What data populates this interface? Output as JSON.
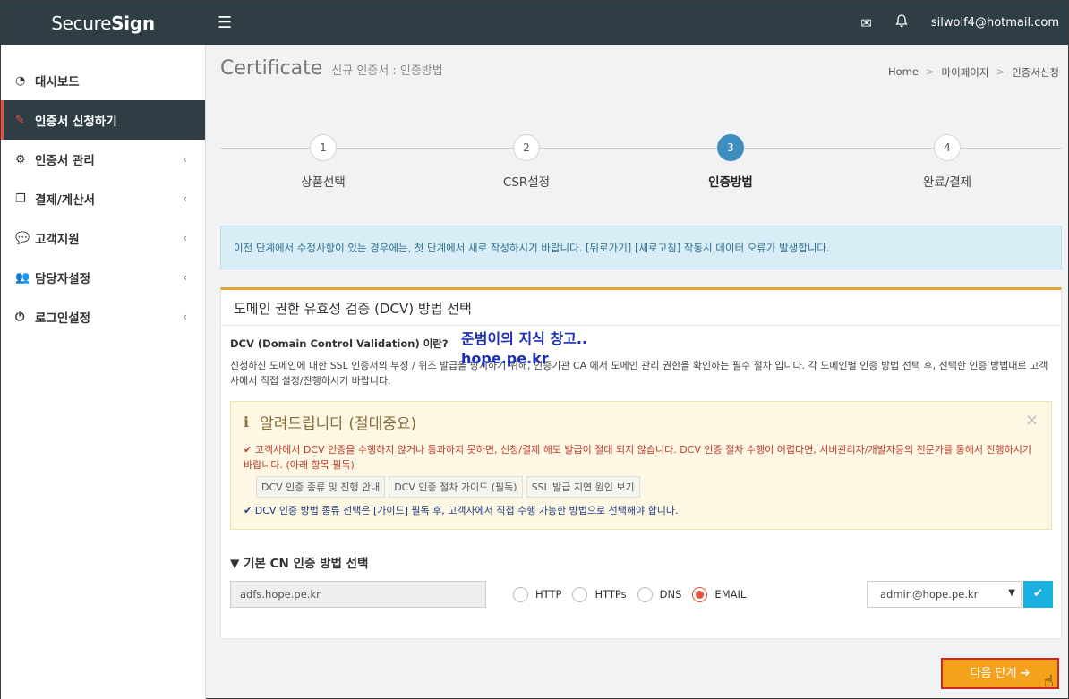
{
  "topbar": {
    "brand_light": "Secure",
    "brand_bold": "Sign",
    "email": "silwolf4@hotmail.com"
  },
  "sidebar": {
    "items": [
      {
        "label": "대시보드",
        "icon": "dashboard-icon",
        "has_chevron": false,
        "active": false
      },
      {
        "label": "인증서 신청하기",
        "icon": "edit-icon",
        "has_chevron": false,
        "active": true
      },
      {
        "label": "인증서 관리",
        "icon": "gears-icon",
        "has_chevron": true,
        "active": false
      },
      {
        "label": "결제/계산서",
        "icon": "copy-icon",
        "has_chevron": true,
        "active": false
      },
      {
        "label": "고객지원",
        "icon": "comments-icon",
        "has_chevron": true,
        "active": false
      },
      {
        "label": "담당자설정",
        "icon": "users-icon",
        "has_chevron": true,
        "active": false
      },
      {
        "label": "로그인설정",
        "icon": "power-icon",
        "has_chevron": true,
        "active": false
      }
    ]
  },
  "page": {
    "title": "Certificate",
    "subtitle": "신규 인증서 : 인증방법"
  },
  "breadcrumb": [
    "Home",
    "마이페이지",
    "인증서신청"
  ],
  "steps": [
    {
      "number": "1",
      "label": "상품선택"
    },
    {
      "number": "2",
      "label": "CSR설정"
    },
    {
      "number": "3",
      "label": "인증방법"
    },
    {
      "number": "4",
      "label": "완료/결제"
    }
  ],
  "current_step": 3,
  "info_alert": "이전 단계에서 수정사항이 있는 경우에는, 첫 단계에서 새로 작성하시기 바랍니다. [뒤로가기] [새로고침] 작동시 데이터 오류가 발생합니다.",
  "panel": {
    "title": "도메인 권한 유효성 검증 (DCV) 방법 선택",
    "dcv_question": "DCV (Domain Control Validation) 이란?",
    "dcv_description": "신청하신 도메인에 대한 SSL 인증서의 부정 / 위조 발급을 방지하기 위해, 인증기관 CA 에서 도메인 관리 권한을 확인하는 필수 절차 입니다. 각 도메인별 인증 방법 선택 후, 선택한 인증 방법대로 고객사에서 직접 설정/진행하시기 바랍니다.",
    "watermark_line1": "준범이의 지식 창고..",
    "watermark_line2": "hope.pe.kr"
  },
  "notice": {
    "title": "알려드립니다 (절대중요)",
    "close": "×",
    "red_text": "고객사에서 DCV 인증을 수행하지 않거나 통과하지 못하면, 신청/결제 해도 발급이 절대 되지 않습니다. DCV 인증 절차 수행이 어렵다면, 서버관리자/개발자등의 전문가를 통해서 진행하시기 바랍니다. (아래 항목 필독)",
    "guide_buttons": [
      "DCV 인증 종류 및 진행 안내",
      "DCV 인증 절차 가이드 (필독)",
      "SSL 발급 지연 원인 보기"
    ],
    "blue_text": "DCV 인증 방법 종류 선택은 [가이드] 필독 후, 고객사에서 직접 수행 가능한 방법으로 선택해야 합니다."
  },
  "cn_section": {
    "title": "▼ 기본 CN 인증 방법 선택",
    "domain": "adfs.hope.pe.kr",
    "methods": [
      "HTTP",
      "HTTPs",
      "DNS",
      "EMAIL"
    ],
    "selected_method": "EMAIL",
    "email_selected": "admin@hope.pe.kr"
  },
  "next_button": "다음 단계",
  "colors": {
    "topbar": "#2f3d45",
    "accent_red": "#e8513b",
    "step_active": "#3d8ebf",
    "next_button": "#f4a21c",
    "confirm_button": "#1ab1e1"
  }
}
